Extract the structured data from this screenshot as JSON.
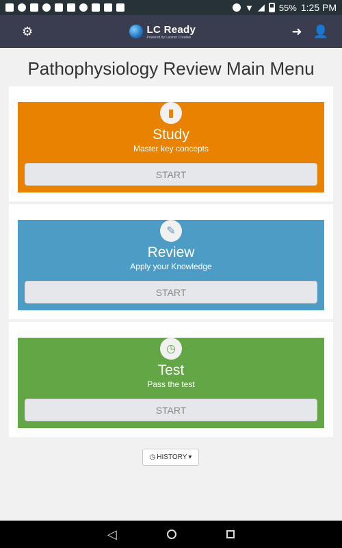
{
  "status_bar": {
    "battery": "55%",
    "time": "1:25 PM"
  },
  "app_bar": {
    "logo_title": "LC Ready",
    "logo_subtitle": "Powered by Lanmer Creative"
  },
  "page_title": "Pathophysiology Review Main Menu",
  "modules": [
    {
      "title": "Study",
      "subtitle": "Master key concepts",
      "button": "START",
      "icon": "book-icon",
      "color": "#ea8201"
    },
    {
      "title": "Review",
      "subtitle": "Apply your Knowledge",
      "button": "START",
      "icon": "pencil-icon",
      "color": "#4d9cc6"
    },
    {
      "title": "Test",
      "subtitle": "Pass the test",
      "button": "START",
      "icon": "clock-icon",
      "color": "#63a646"
    }
  ],
  "history_button": {
    "label": "HISTORY",
    "icon": "clock-icon"
  },
  "icons": {
    "settings": "gear-icon",
    "sign_in": "sign-in-icon",
    "add_user": "add-user-icon"
  }
}
